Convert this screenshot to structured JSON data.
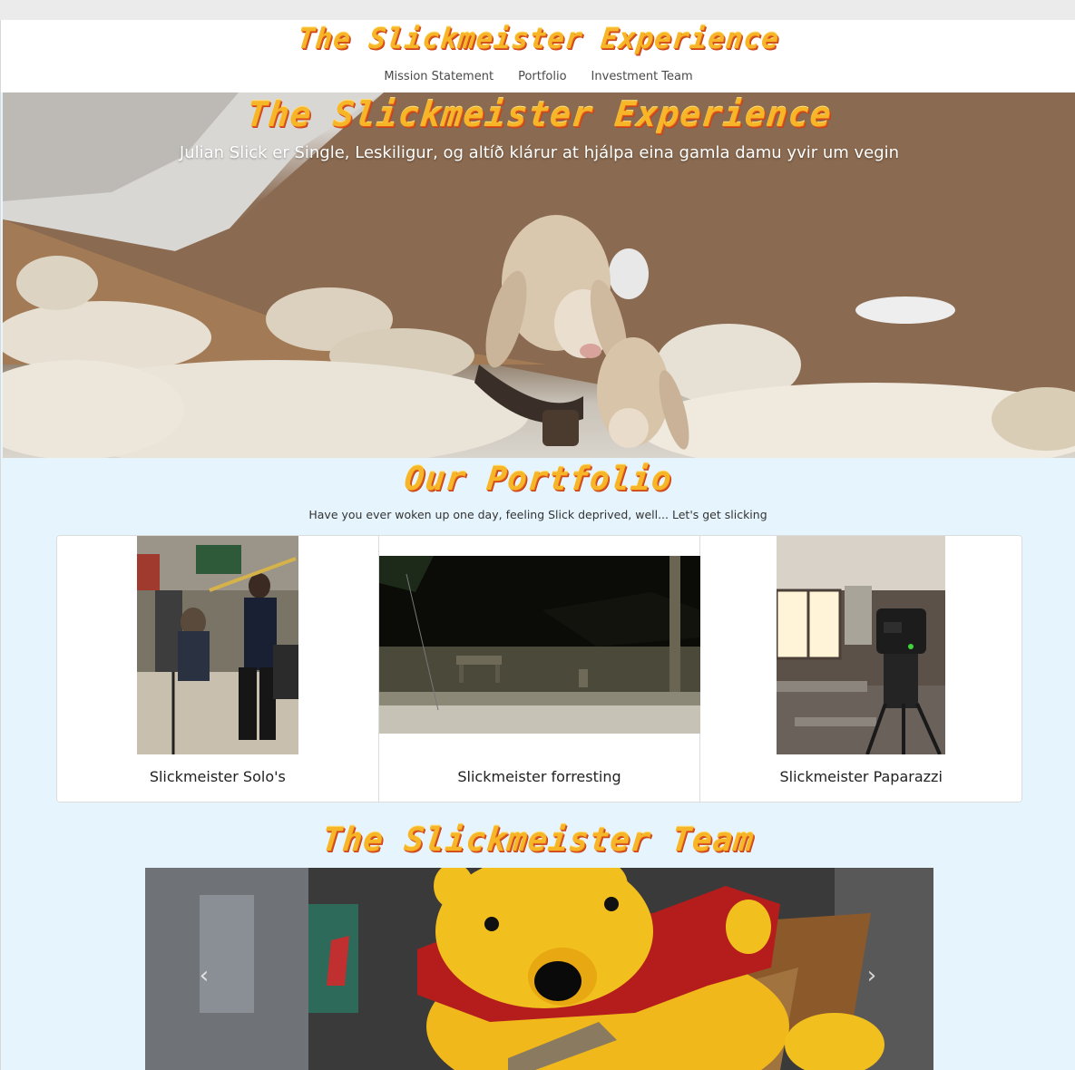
{
  "navbar": {
    "brand": "The Slickmeister Experience",
    "links": [
      "Mission Statement",
      "Portfolio",
      "Investment Team"
    ]
  },
  "hero": {
    "title": "The Slickmeister Experience",
    "subtitle": "Julian Slick er Single, Leskiligur, og altíð klárur at hjálpa eina gamla damu yvir um vegin"
  },
  "portfolio": {
    "title": "Our Portfolio",
    "subtitle": "Have you ever woken up one day, feeling Slick deprived, well... Let's get slicking",
    "cards": [
      {
        "title": "Slickmeister Solo's"
      },
      {
        "title": "Slickmeister forresting"
      },
      {
        "title": "Slickmeister Paparazzi"
      }
    ]
  },
  "team": {
    "title": "The Slickmeister Team",
    "prev_icon": "chevron-left-icon",
    "next_icon": "chevron-right-icon",
    "prev_glyph": "‹",
    "next_glyph": "›"
  },
  "colors": {
    "brand_gold": "#f7b528",
    "brand_shadow": "#c8401a",
    "page_bg": "#e6f5fd"
  }
}
